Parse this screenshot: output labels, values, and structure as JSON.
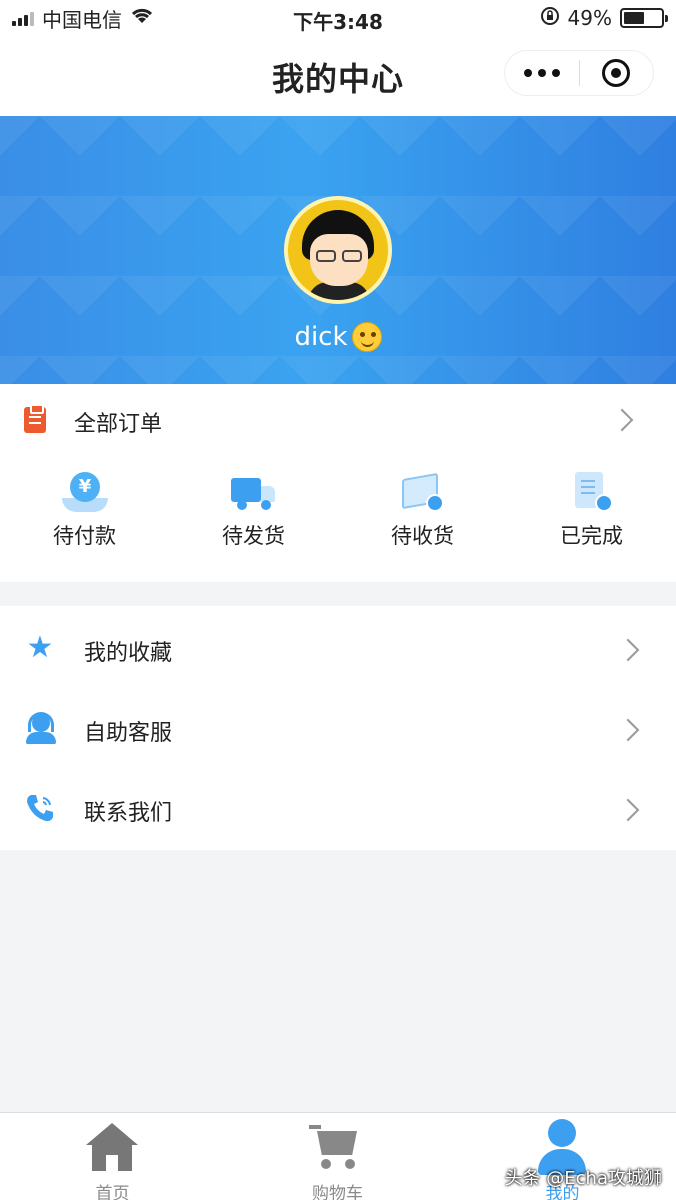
{
  "status_bar": {
    "carrier": "中国电信",
    "time": "下午3:48",
    "battery": "49%"
  },
  "nav": {
    "title": "我的中心"
  },
  "profile": {
    "username": "dick"
  },
  "orders": {
    "all_label": "全部订单",
    "statuses": [
      {
        "label": "待付款",
        "icon": "yuan-coin-icon"
      },
      {
        "label": "待发货",
        "icon": "truck-icon"
      },
      {
        "label": "待收货",
        "icon": "package-icon"
      },
      {
        "label": "已完成",
        "icon": "document-check-icon"
      }
    ]
  },
  "menu": [
    {
      "label": "我的收藏",
      "icon": "star-icon"
    },
    {
      "label": "自助客服",
      "icon": "headset-icon"
    },
    {
      "label": "联系我们",
      "icon": "phone-icon"
    }
  ],
  "tab_bar": [
    {
      "label": "首页",
      "icon": "home-icon"
    },
    {
      "label": "购物车",
      "icon": "cart-icon"
    },
    {
      "label": "我的",
      "icon": "person-icon",
      "active": true
    }
  ],
  "watermark": "头条 @Echa攻城狮",
  "colors": {
    "accent": "#3d9ff0",
    "orders_icon": "#ee5a2e",
    "banner": "#3a8ee6"
  }
}
